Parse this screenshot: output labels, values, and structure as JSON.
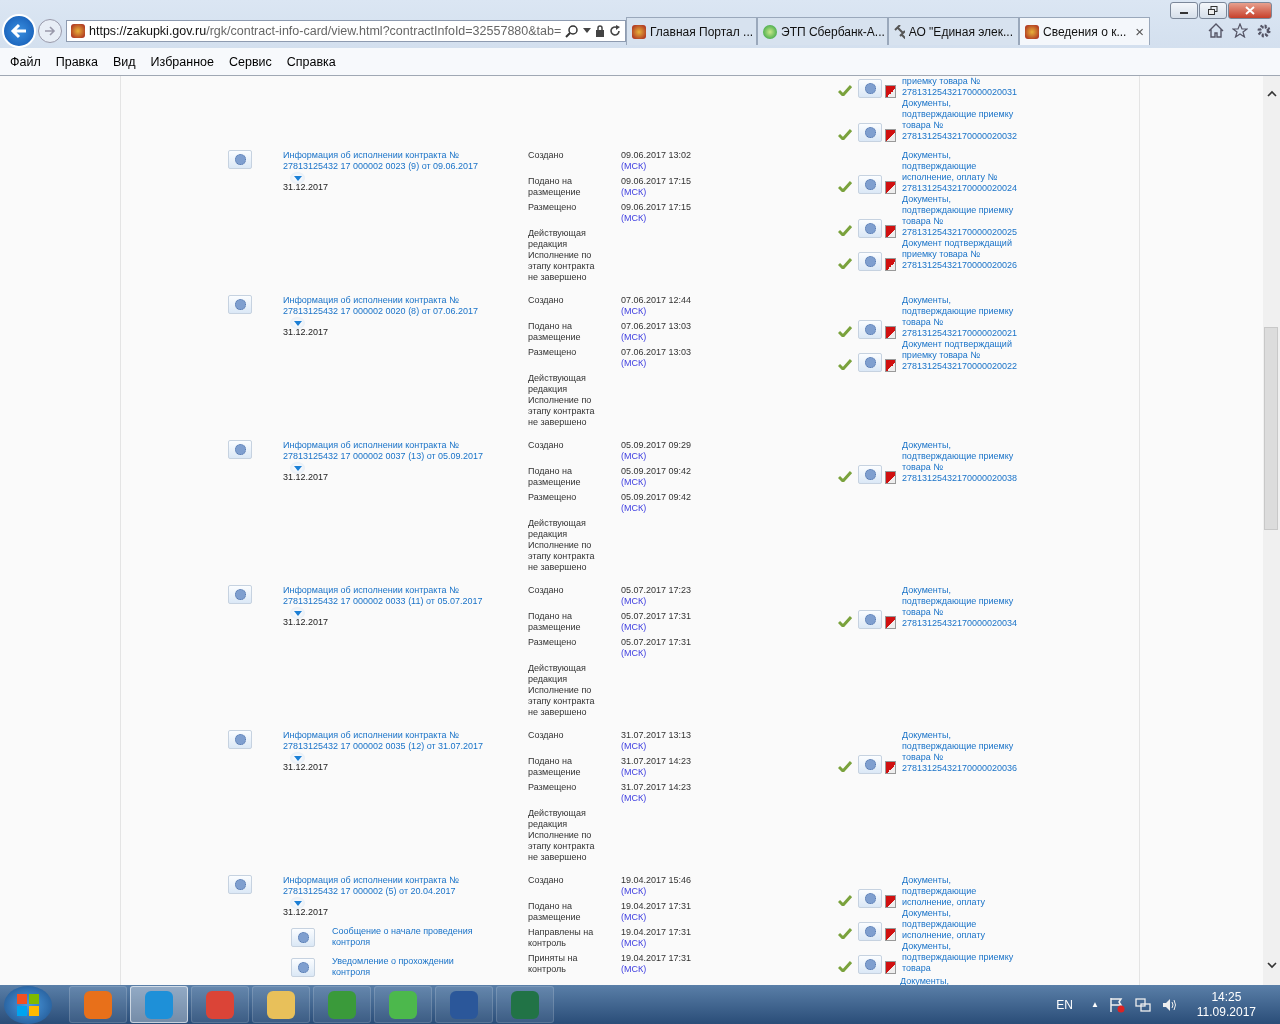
{
  "address_bar": {
    "host": "https://zakupki.gov.ru",
    "path": "/rgk/contract-info-card/view.html?contractInfoId=32557880&tab="
  },
  "tabs": [
    {
      "label": "Главная Портал ...",
      "selected": false
    },
    {
      "label": "ЭТП Сбербанк-А...",
      "selected": false
    },
    {
      "label": "АО \"Единая элек...",
      "selected": false
    },
    {
      "label": "Сведения о к...",
      "selected": true,
      "close": "×"
    }
  ],
  "menu": [
    "Файл",
    "Правка",
    "Вид",
    "Избранное",
    "Сервис",
    "Справка"
  ],
  "partial_docs": [
    {
      "text": "приемку товара № 27813125432170000020031",
      "signed": true
    },
    {
      "text": "Документы, подтверждающие приемку товара № 27813125432170000020032",
      "signed": true
    }
  ],
  "entries": [
    {
      "title": "Информация об исполнении контракта № 27813125432 17 000002 0023 (9) от 09.06.2017",
      "end_date": "31.12.2017",
      "events": [
        {
          "label": "Создано",
          "date": "09.06.2017 13:02",
          "tz": "(МСК)"
        },
        {
          "label": "Подано на размещение",
          "date": "09.06.2017 17:15",
          "tz": "(МСК)"
        },
        {
          "label": "Размещено",
          "date": "09.06.2017 17:15",
          "tz": "(МСК)"
        }
      ],
      "status": [
        "Действующая редакция",
        "Исполнение по этапу контракта не завершено"
      ],
      "docs": [
        {
          "text": "Документы, подтверждающие исполнение, оплату № 27813125432170000020024",
          "signed": true
        },
        {
          "text": "Документы, подтверждающие приемку товара № 27813125432170000020025",
          "signed": true
        },
        {
          "text": "Документ подтверждащий приемку товара № 27813125432170000020026",
          "signed": true
        }
      ]
    },
    {
      "title": "Информация об исполнении контракта № 27813125432 17 000002 0020 (8) от 07.06.2017",
      "end_date": "31.12.2017",
      "events": [
        {
          "label": "Создано",
          "date": "07.06.2017 12:44",
          "tz": "(МСК)"
        },
        {
          "label": "Подано на размещение",
          "date": "07.06.2017 13:03",
          "tz": "(МСК)"
        },
        {
          "label": "Размещено",
          "date": "07.06.2017 13:03",
          "tz": "(МСК)"
        }
      ],
      "status": [
        "Действующая редакция",
        "Исполнение по этапу контракта не завершено"
      ],
      "docs": [
        {
          "text": "Документы, подтверждающие приемку товара № 27813125432170000020021",
          "signed": true
        },
        {
          "text": "Документ подтверждащий приемку товара № 27813125432170000020022",
          "signed": true
        }
      ]
    },
    {
      "title": "Информация об исполнении контракта № 27813125432 17 000002 0037 (13) от 05.09.2017",
      "end_date": "31.12.2017",
      "events": [
        {
          "label": "Создано",
          "date": "05.09.2017 09:29",
          "tz": "(МСК)"
        },
        {
          "label": "Подано на размещение",
          "date": "05.09.2017 09:42",
          "tz": "(МСК)"
        },
        {
          "label": "Размещено",
          "date": "05.09.2017 09:42",
          "tz": "(МСК)"
        }
      ],
      "status": [
        "Действующая редакция",
        "Исполнение по этапу контракта не завершено"
      ],
      "docs": [
        {
          "text": "Документы, подтверждающие приемку товара № 27813125432170000020038",
          "signed": true
        }
      ]
    },
    {
      "title": "Информация об исполнении контракта № 27813125432 17 000002 0033 (11) от 05.07.2017",
      "end_date": "31.12.2017",
      "events": [
        {
          "label": "Создано",
          "date": "05.07.2017 17:23",
          "tz": "(МСК)"
        },
        {
          "label": "Подано на размещение",
          "date": "05.07.2017 17:31",
          "tz": "(МСК)"
        },
        {
          "label": "Размещено",
          "date": "05.07.2017 17:31",
          "tz": "(МСК)"
        }
      ],
      "status": [
        "Действующая редакция",
        "Исполнение по этапу контракта не завершено"
      ],
      "docs": [
        {
          "text": "Документы, подтверждающие приемку товара № 27813125432170000020034",
          "signed": true
        }
      ]
    },
    {
      "title": "Информация об исполнении контракта № 27813125432 17 000002 0035 (12) от 31.07.2017",
      "end_date": "31.12.2017",
      "events": [
        {
          "label": "Создано",
          "date": "31.07.2017 13:13",
          "tz": "(МСК)"
        },
        {
          "label": "Подано на размещение",
          "date": "31.07.2017 14:23",
          "tz": "(МСК)"
        },
        {
          "label": "Размещено",
          "date": "31.07.2017 14:23",
          "tz": "(МСК)"
        }
      ],
      "status": [
        "Действующая редакция",
        "Исполнение по этапу контракта не завершено"
      ],
      "docs": [
        {
          "text": "Документы, подтверждающие приемку товара № 27813125432170000020036",
          "signed": true
        }
      ]
    },
    {
      "title": "Информация об исполнении контракта № 27813125432 17 000002 (5) от 20.04.2017",
      "end_date": "31.12.2017",
      "subdocs": [
        "Сообщение о начале проведения контроля",
        "Уведомление о прохождении контроля"
      ],
      "events": [
        {
          "label": "Создано",
          "date": "19.04.2017 15:46",
          "tz": "(МСК)"
        },
        {
          "label": "Подано на размещение",
          "date": "19.04.2017 17:31",
          "tz": "(МСК)"
        },
        {
          "label": "Направлены на контроль",
          "date": "19.04.2017 17:31",
          "tz": "(МСК)"
        },
        {
          "label": "Приняты на контроль",
          "date": "19.04.2017 17:31",
          "tz": "(МСК)"
        }
      ],
      "docs": [
        {
          "text": "Документы, подтверждающие исполнение, оплату",
          "signed": true
        },
        {
          "text": "Документы, подтверждающие исполнение, оплату",
          "signed": true
        },
        {
          "text": "Документы, подтверждающие приемку товара",
          "signed": true
        },
        {
          "text": "Документы,",
          "signed": false
        }
      ]
    }
  ],
  "taskbar": {
    "apps": [
      {
        "selected": false
      },
      {
        "selected": true
      },
      {
        "selected": false
      },
      {
        "selected": false
      },
      {
        "selected": false
      },
      {
        "selected": false
      },
      {
        "selected": false
      },
      {
        "selected": false
      }
    ],
    "language": "EN",
    "tray_arrow": "▲",
    "time": "14:25",
    "date": "11.09.2017"
  }
}
